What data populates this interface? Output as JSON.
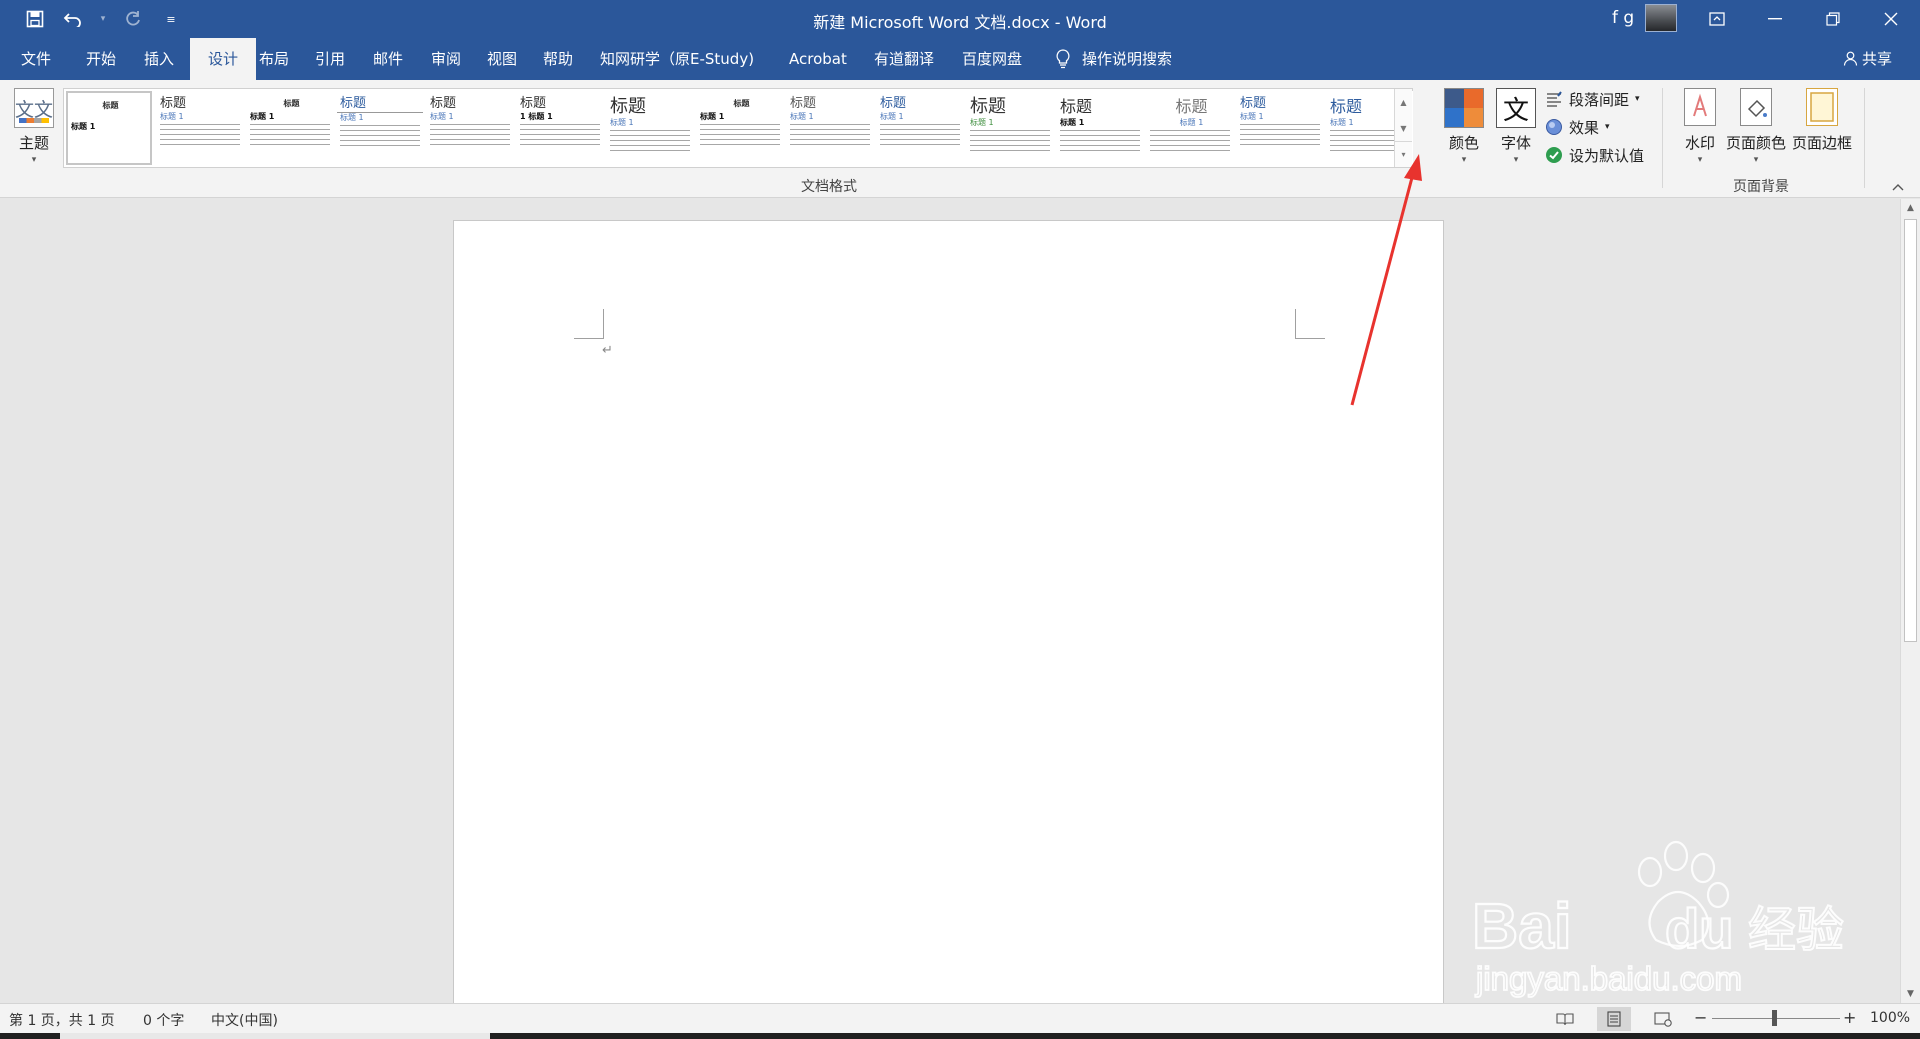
{
  "title_bar": {
    "document_title": "新建 Microsoft Word 文档.docx  -  Word",
    "user_initials": "f g",
    "qat_icons": [
      "save-icon",
      "undo-icon",
      "redo-icon",
      "customize-qat-icon"
    ],
    "window_controls": [
      "ribbon-display-icon",
      "minimize-icon",
      "restore-icon",
      "close-icon"
    ]
  },
  "tabs": [
    {
      "label": "文件"
    },
    {
      "label": "开始"
    },
    {
      "label": "插入"
    },
    {
      "label": "设计",
      "active": true
    },
    {
      "label": "布局"
    },
    {
      "label": "引用"
    },
    {
      "label": "邮件"
    },
    {
      "label": "审阅"
    },
    {
      "label": "视图"
    },
    {
      "label": "帮助"
    },
    {
      "label": "知网研学（原E-Study)"
    },
    {
      "label": "Acrobat"
    },
    {
      "label": "有道翻译"
    },
    {
      "label": "百度网盘"
    }
  ],
  "tell_me": {
    "label": "操作说明搜索",
    "icon": "lightbulb-icon"
  },
  "share": {
    "label": "共享",
    "icon": "person-icon"
  },
  "ribbon": {
    "theme_button": {
      "label": "主题",
      "glyph": "文文"
    },
    "gallery": [
      {
        "heading": "标题",
        "sub": "标题 1"
      },
      {
        "heading": "标题",
        "sub": "标题 1"
      },
      {
        "heading": "标题",
        "sub": "标题 1"
      },
      {
        "heading": "标题",
        "sub": "标题 1"
      },
      {
        "heading": "标题",
        "sub": "标题 1"
      },
      {
        "heading": "标题",
        "sub": "1  标题 1"
      },
      {
        "heading": "标题",
        "sub": "标题 1"
      },
      {
        "heading": "标题",
        "sub": "标题 1"
      },
      {
        "heading": "标题",
        "sub": "标题 1"
      },
      {
        "heading": "标题",
        "sub": "标题 1"
      },
      {
        "heading": "标题",
        "sub": "标题 1"
      },
      {
        "heading": "标题",
        "sub": "标题 1"
      },
      {
        "heading": "标题",
        "sub": "标题 1"
      },
      {
        "heading": "标题",
        "sub": "标题 1"
      },
      {
        "heading": "标题",
        "sub": "标题 1"
      }
    ],
    "group_document_formatting": "文档格式",
    "colors_button": {
      "label": "颜色"
    },
    "fonts_button": {
      "label": "字体",
      "glyph": "文"
    },
    "paragraph_spacing": {
      "label": "段落间距"
    },
    "effects": {
      "label": "效果"
    },
    "set_default": {
      "label": "设为默认值"
    },
    "watermark_button": {
      "label": "水印"
    },
    "page_color_button": {
      "label": "页面颜色"
    },
    "page_borders_button": {
      "label": "页面边框"
    },
    "group_page_background": "页面背景",
    "accent_colors": [
      "#3d5a8a",
      "#e96a2b",
      "#2f72c9",
      "#ee8c3a"
    ]
  },
  "document": {
    "paragraph_mark": "↵"
  },
  "status_bar": {
    "page_info": "第 1 页，共 1 页",
    "word_count": "0 个字",
    "language": "中文(中国)",
    "zoom_level": "100%",
    "zoom_minus": "−",
    "zoom_plus": "+"
  },
  "watermark": {
    "brand": "Bai du 经验",
    "url": "jingyan.baidu.com"
  },
  "colors": {
    "titlebar": "#2b579a",
    "ribbon": "#f3f3f3",
    "workspace": "#e6e6e6",
    "annotation_arrow": "#e8332e"
  }
}
